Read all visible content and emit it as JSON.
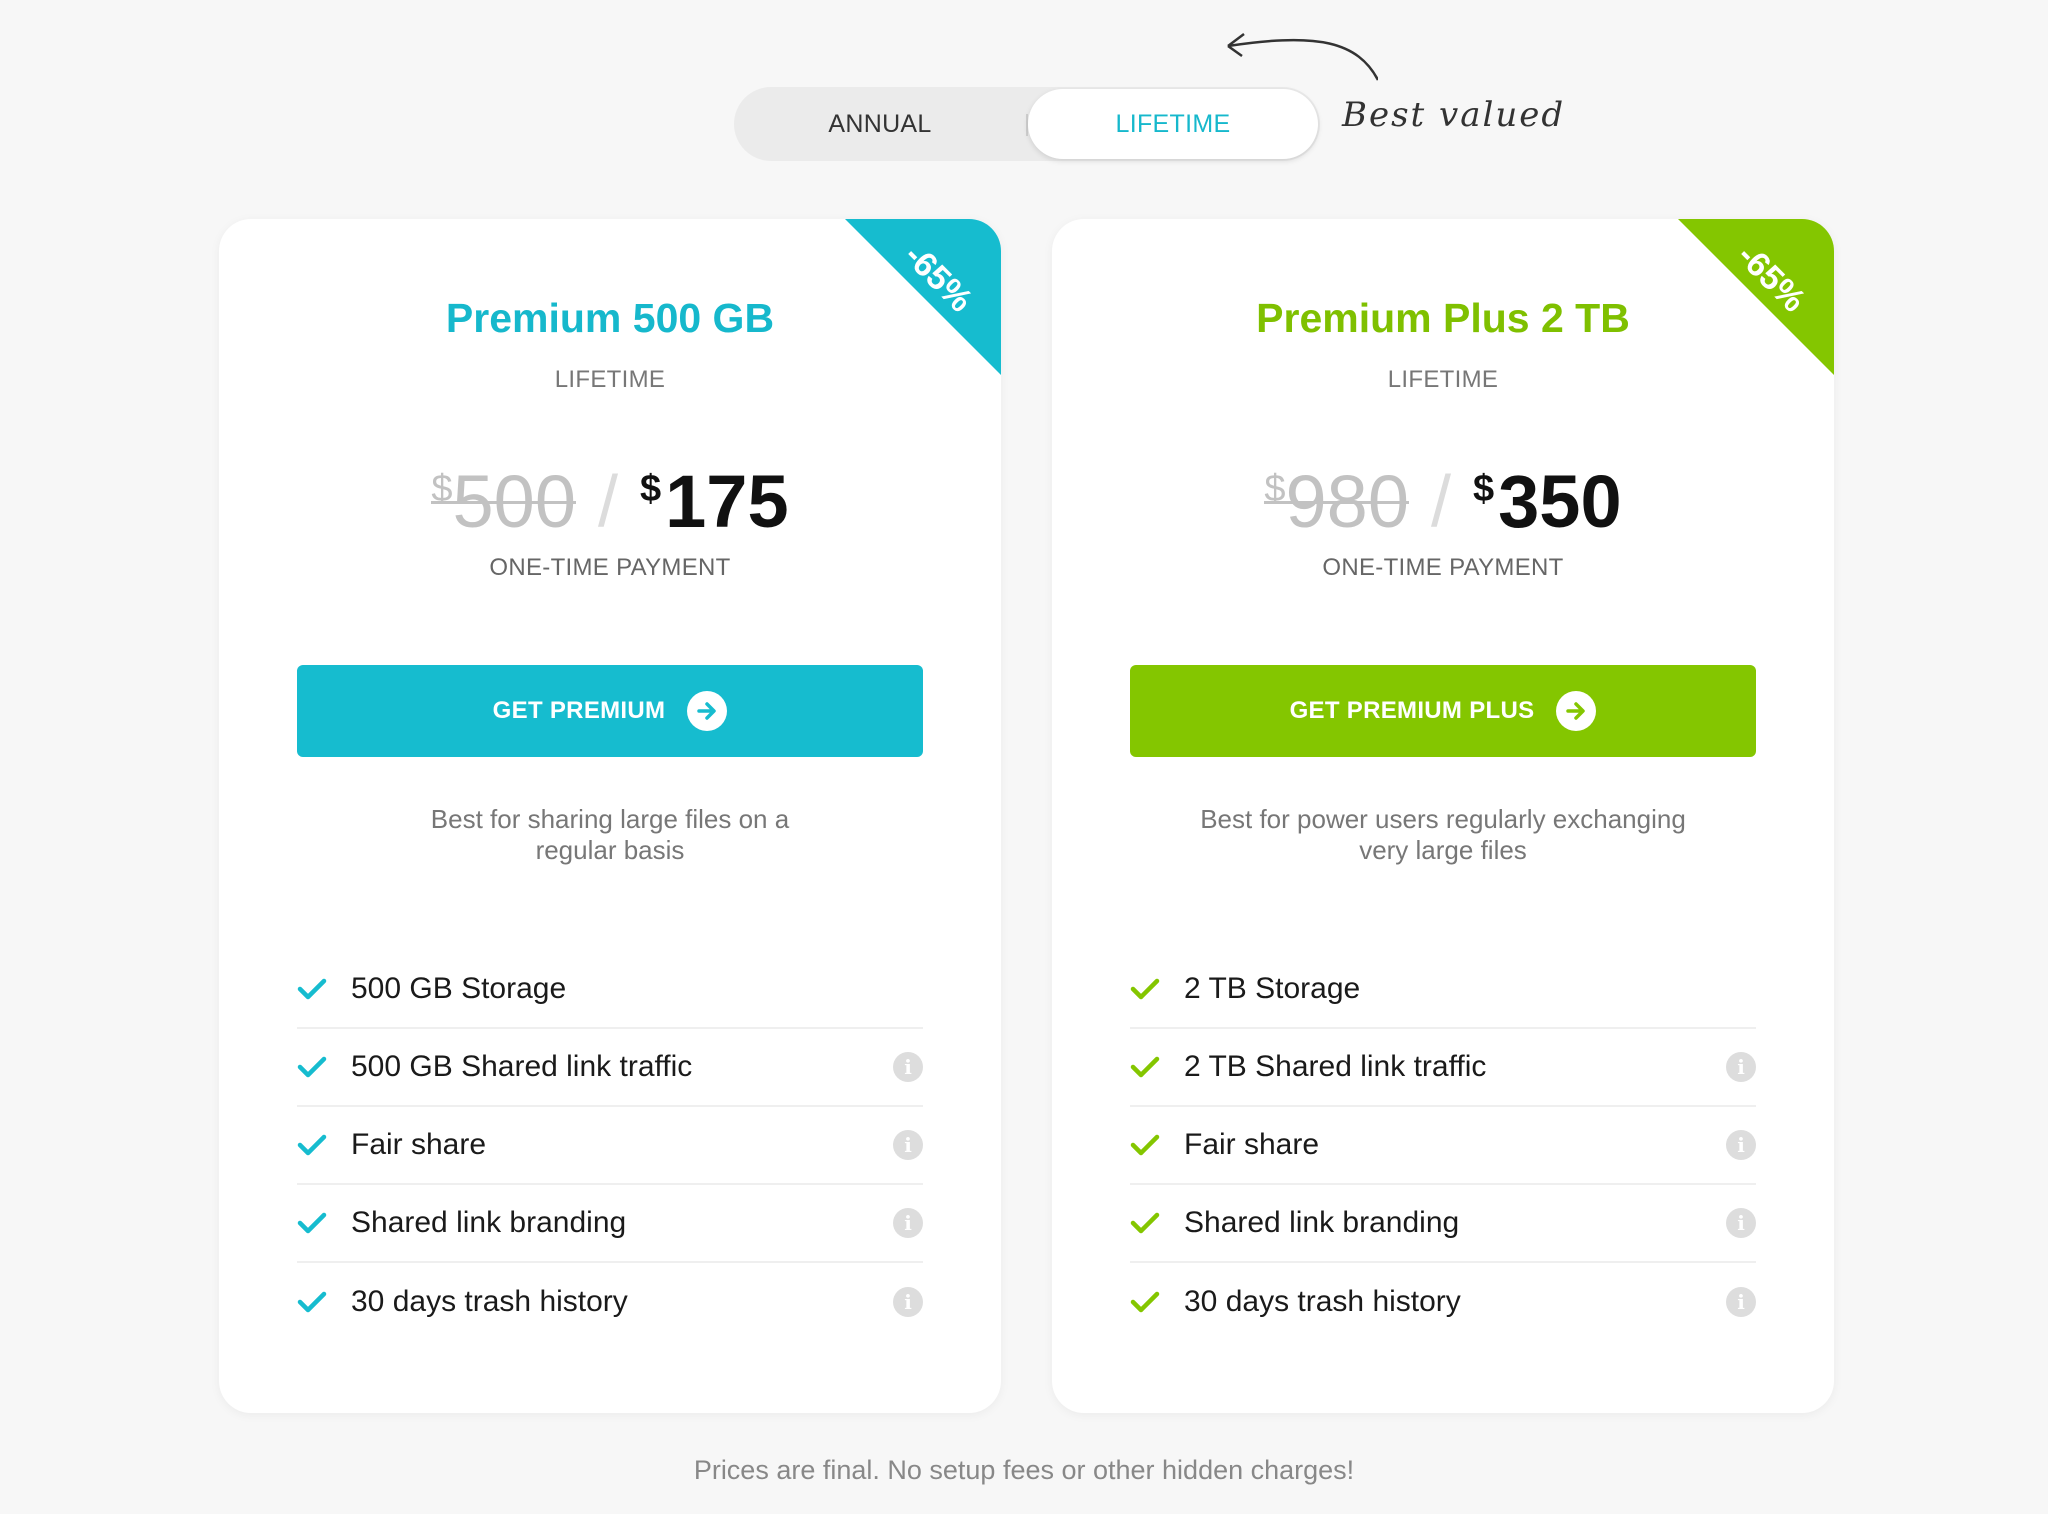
{
  "toggle": {
    "options": [
      "ANNUAL",
      "LIFETIME"
    ],
    "selected": "LIFETIME",
    "note": "Best valued"
  },
  "plans": [
    {
      "badge": "-65%",
      "name": "Premium 500 GB",
      "term": "LIFETIME",
      "currency": "$",
      "old_price": "500",
      "new_price": "175",
      "price_note": "ONE-TIME PAYMENT",
      "cta_label": "GET PREMIUM",
      "blurb_line1": "Best for sharing large files on a",
      "blurb_line2": "regular basis",
      "accent": "#16bccf",
      "features": [
        "500 GB Storage",
        "500 GB Shared link traffic",
        "Fair share",
        "Shared link branding",
        "30 days trash history"
      ]
    },
    {
      "badge": "-65%",
      "name": "Premium Plus 2 TB",
      "term": "LIFETIME",
      "currency": "$",
      "old_price": "980",
      "new_price": "350",
      "price_note": "ONE-TIME PAYMENT",
      "cta_label": "GET PREMIUM PLUS",
      "blurb_line1": "Best for power users regularly exchanging",
      "blurb_line2": "very large files",
      "accent": "#84c600",
      "features": [
        "2 TB Storage",
        "2 TB Shared link traffic",
        "Fair share",
        "Shared link branding",
        "30 days trash history"
      ]
    }
  ],
  "footer": "Prices are final. No setup fees or other hidden charges!",
  "icons": {
    "check": "check-icon",
    "info": "info-icon",
    "cta_arrow": "arrow-right-circle-icon",
    "note_arrow": "curved-arrow-icon"
  }
}
